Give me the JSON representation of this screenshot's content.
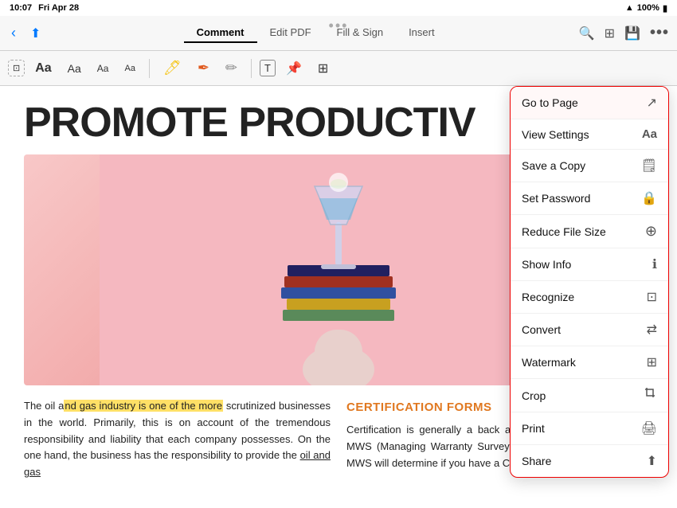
{
  "status_bar": {
    "time": "10:07",
    "day": "Fri Apr 28",
    "battery": "100%",
    "battery_icon": "🔋",
    "wifi_icon": "📶"
  },
  "toolbar": {
    "back_icon": "‹",
    "share_icon": "⬆",
    "dots": "•••",
    "tabs": [
      {
        "label": "Comment",
        "active": true
      },
      {
        "label": "Edit PDF",
        "active": false
      },
      {
        "label": "Fill & Sign",
        "active": false
      },
      {
        "label": "Insert",
        "active": false
      }
    ],
    "search_label": "Search",
    "grid_label": "Grid",
    "save_label": "Save",
    "more_label": "More"
  },
  "sub_toolbar": {
    "text_aa_large": "Aa",
    "text_aa_med": "Aa",
    "text_aa_small1": "Aa",
    "text_aa_small2": "Aa",
    "highlight_icon": "🖊",
    "pen_icon": "✒",
    "pencil_icon": "✏",
    "text_icon": "T",
    "sticky_icon": "📌",
    "stamp_icon": "⊞"
  },
  "dropdown_menu": {
    "items": [
      {
        "label": "Go to Page",
        "icon": "↗",
        "active": true
      },
      {
        "label": "View Settings",
        "icon": "Aa"
      },
      {
        "label": "Save a Copy",
        "icon": "🗒"
      },
      {
        "label": "Set Password",
        "icon": "🔒"
      },
      {
        "label": "Reduce File Size",
        "icon": "⊕"
      },
      {
        "label": "Show Info",
        "icon": "ⓘ"
      },
      {
        "label": "Recognize",
        "icon": "⊡"
      },
      {
        "label": "Convert",
        "icon": "⇄"
      },
      {
        "label": "Watermark",
        "icon": "⊞"
      },
      {
        "label": "Crop",
        "icon": "⬜"
      },
      {
        "label": "Print",
        "icon": "🖨"
      },
      {
        "label": "Share",
        "icon": "⬆"
      }
    ]
  },
  "pdf": {
    "title": "PROMOTE PRODUCTIV",
    "text_left": "The oil and gas industry is one of the more scrutinized businesses in the world. Primarily, this is on account of the tremendous responsibility and liability that each company possesses. On the one hand, the business has the responsibility to provide the oil and gas",
    "highlight_phrase": "nd gas industry is one of the more",
    "section_title": "CERTIFICATION FORMS",
    "text_right": "Certification is generally a back and forth of fixes between the MWS (Managing Warranty Surveyor) and the insurer. Since the MWS will determine if you have a COA (Certificate"
  }
}
